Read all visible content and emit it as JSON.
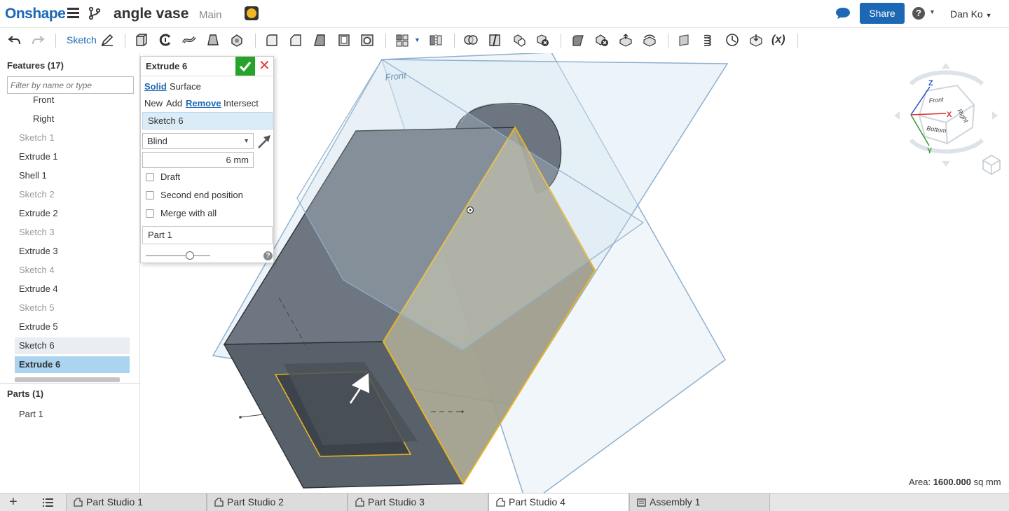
{
  "header": {
    "logo": "Onshape",
    "document_title": "angle vase",
    "branch": "Main",
    "share_label": "Share",
    "help_label": "?",
    "user_name": "Dan Ko",
    "accent_color": "#1d68b5"
  },
  "toolbar": {
    "sketch_label": "Sketch",
    "icons": [
      "undo-icon",
      "redo-icon",
      "sketch-pencil-icon",
      "extrude-icon",
      "revolve-icon",
      "sweep-icon",
      "loft-icon",
      "thicken-icon",
      "fillet-icon",
      "chamfer-icon",
      "draft-icon",
      "shell-icon",
      "hole-icon",
      "pattern-icon",
      "mirror-icon",
      "boolean-icon",
      "split-icon",
      "transform-icon",
      "delete-part-icon",
      "modify-fillet-icon",
      "delete-face-icon",
      "move-face-icon",
      "replace-face-icon",
      "plane-icon",
      "helix-icon",
      "mate-connector-icon",
      "import-icon",
      "variable-icon"
    ],
    "variable_label": "(x)"
  },
  "features": {
    "header": "Features (17)",
    "filter_placeholder": "Filter by name or type",
    "items": [
      {
        "label": "Front",
        "state": "plane"
      },
      {
        "label": "Right",
        "state": "plane"
      },
      {
        "label": "Sketch 1",
        "state": "dim"
      },
      {
        "label": "Extrude 1",
        "state": "normal"
      },
      {
        "label": "Shell 1",
        "state": "normal"
      },
      {
        "label": "Sketch 2",
        "state": "dim"
      },
      {
        "label": "Extrude 2",
        "state": "normal"
      },
      {
        "label": "Sketch 3",
        "state": "dim"
      },
      {
        "label": "Extrude 3",
        "state": "normal"
      },
      {
        "label": "Sketch 4",
        "state": "dim"
      },
      {
        "label": "Extrude 4",
        "state": "normal"
      },
      {
        "label": "Sketch 5",
        "state": "dim"
      },
      {
        "label": "Extrude 5",
        "state": "normal"
      },
      {
        "label": "Sketch 6",
        "state": "hover"
      },
      {
        "label": "Extrude 6",
        "state": "selected"
      }
    ]
  },
  "parts": {
    "header": "Parts (1)",
    "items": [
      "Part 1"
    ]
  },
  "dialog": {
    "title": "Extrude 6",
    "body_types": {
      "solid": "Solid",
      "surface": "Surface"
    },
    "operations": {
      "new": "New",
      "add": "Add",
      "remove": "Remove",
      "intersect": "Intersect"
    },
    "selected_body_type": "Solid",
    "selected_operation": "Remove",
    "sketch_selection": "Sketch 6",
    "end_type": "Blind",
    "depth": "6 mm",
    "draft_label": "Draft",
    "second_end_label": "Second end position",
    "merge_label": "Merge with all",
    "merge_scope": "Part 1",
    "draft_checked": false,
    "second_end_checked": false,
    "merge_checked": false,
    "ok_color": "#26a32a",
    "cancel_color": "#e23b2e"
  },
  "viewport": {
    "plane_label": "Front",
    "view_cube": {
      "front": "Front",
      "right": "Right",
      "bottom": "Bottom",
      "axis_x": "X",
      "axis_y": "Y",
      "axis_z": "Z"
    },
    "area_label": "Area:",
    "area_value": "1600.000",
    "area_unit": "sq mm"
  },
  "tabs": [
    {
      "label": "Part Studio 1",
      "active": false,
      "kind": "part-studio"
    },
    {
      "label": "Part Studio 2",
      "active": false,
      "kind": "part-studio"
    },
    {
      "label": "Part Studio 3",
      "active": false,
      "kind": "part-studio"
    },
    {
      "label": "Part Studio 4",
      "active": true,
      "kind": "part-studio"
    },
    {
      "label": "Assembly 1",
      "active": false,
      "kind": "assembly"
    }
  ]
}
